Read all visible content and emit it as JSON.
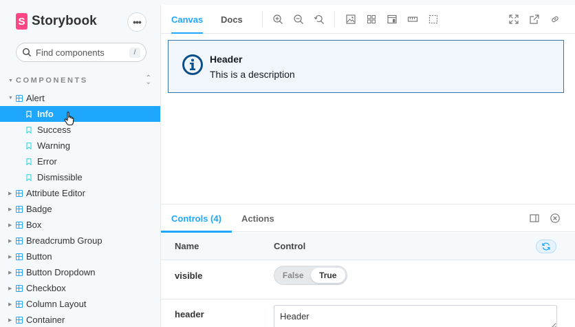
{
  "brand": {
    "name": "Storybook",
    "logo_letter": "S"
  },
  "menu": {
    "label": "•••"
  },
  "search": {
    "placeholder": "Find components",
    "shortcut": "/"
  },
  "section": {
    "label": "COMPONENTS"
  },
  "tree": {
    "alert": {
      "label": "Alert"
    },
    "stories": [
      {
        "label": "Info",
        "selected": true
      },
      {
        "label": "Success"
      },
      {
        "label": "Warning"
      },
      {
        "label": "Error"
      },
      {
        "label": "Dismissible"
      }
    ],
    "components": [
      {
        "label": "Attribute Editor"
      },
      {
        "label": "Badge"
      },
      {
        "label": "Box"
      },
      {
        "label": "Breadcrumb Group"
      },
      {
        "label": "Button"
      },
      {
        "label": "Button Dropdown"
      },
      {
        "label": "Checkbox"
      },
      {
        "label": "Column Layout"
      },
      {
        "label": "Container"
      }
    ]
  },
  "toolbar": {
    "tabs": [
      {
        "label": "Canvas",
        "active": true
      },
      {
        "label": "Docs"
      }
    ],
    "tools": [
      "zoom-in-icon",
      "zoom-out-icon",
      "zoom-reset-icon",
      "background-icon",
      "grid-icon",
      "viewport-icon",
      "measure-icon",
      "outline-icon"
    ],
    "actions": [
      "fullscreen-icon",
      "open-new-tab-icon",
      "copy-link-icon"
    ]
  },
  "alert": {
    "header": "Header",
    "description": "This is a description",
    "border_color": "#3a73a8",
    "bg_color": "#f0f6fc"
  },
  "addons": {
    "tabs": [
      {
        "label": "Controls (4)",
        "active": true
      },
      {
        "label": "Actions"
      }
    ],
    "columns": {
      "name": "Name",
      "control": "Control"
    },
    "rows": {
      "visible": {
        "name": "visible",
        "false_label": "False",
        "true_label": "True",
        "value": true
      },
      "header": {
        "name": "header",
        "value": "Header"
      }
    }
  },
  "colors": {
    "accent": "#1ea7fd",
    "brand": "#ff4785"
  }
}
